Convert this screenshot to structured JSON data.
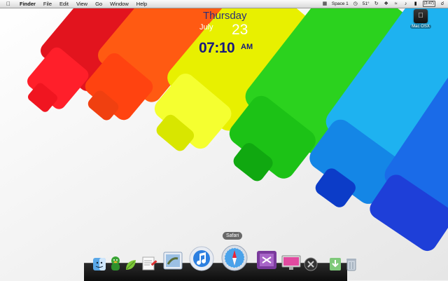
{
  "menubar": {
    "apple_icon": "apple-icon",
    "items": [
      "Finder",
      "File",
      "Edit",
      "View",
      "Go",
      "Window",
      "Help"
    ],
    "space_label": "Space 1",
    "temperature": "51°",
    "time": "(3:47)"
  },
  "clock": {
    "day": "Thursday",
    "month": "July",
    "date": "23",
    "time": "07:10",
    "ampm": "AM"
  },
  "desktop": {
    "drive_label": "Mac OSX"
  },
  "dock": {
    "tooltip": "Safari",
    "items": [
      "finder-icon",
      "adium-icon",
      "leaf-icon",
      "textedit-icon",
      "mail-icon",
      "itunes-icon",
      "safari-icon",
      "plugin-icon",
      "display-icon",
      "x-icon",
      "downloads-icon",
      "trash-icon"
    ]
  },
  "colors": {
    "accent_day": "#2a2f7a",
    "accent_time": "#16197e"
  }
}
